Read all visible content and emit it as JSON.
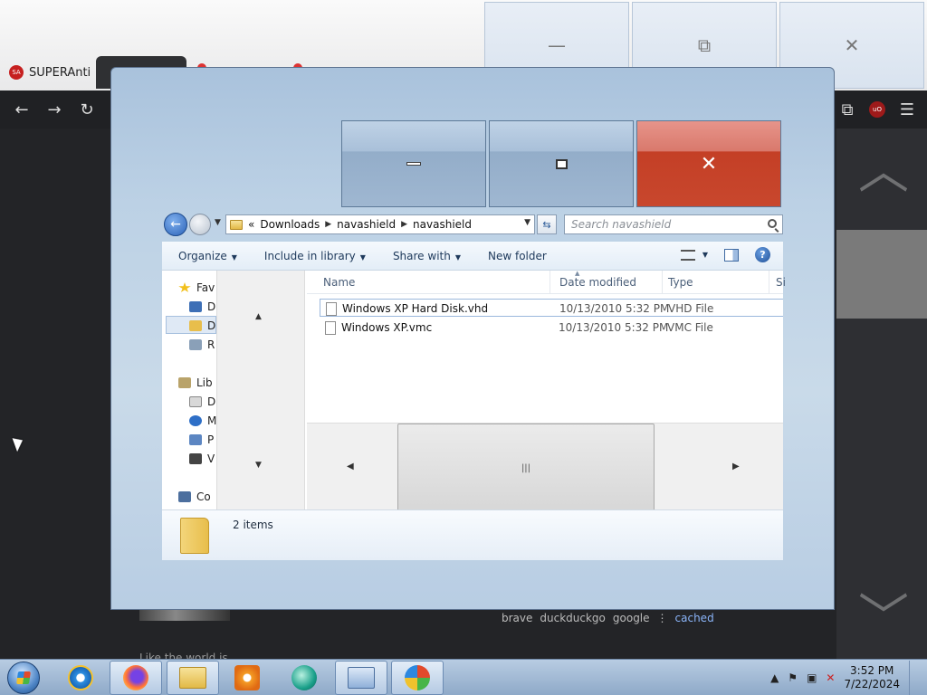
{
  "browser": {
    "tab_label": "SUPERAnti",
    "tab_icon_text": "SA",
    "ublock_text": "uO"
  },
  "top_buttons": {
    "minimize": "—",
    "restore": "⧉",
    "close": "✕"
  },
  "page": {
    "bottom_links": [
      "brave",
      "duckduckgo",
      "google",
      "⋮",
      "cached"
    ],
    "faded_text": "Like the world is..."
  },
  "explorer": {
    "breadcrumb": [
      "«",
      "Downloads",
      "navashield",
      "navashield"
    ],
    "search_placeholder": "Search navashield",
    "commands": [
      {
        "label": "Organize",
        "dropdown": true
      },
      {
        "label": "Include in library",
        "dropdown": true
      },
      {
        "label": "Share with",
        "dropdown": true
      },
      {
        "label": "New folder",
        "dropdown": false
      }
    ],
    "nav_items": [
      {
        "label": "Fav",
        "icon": "star-icon",
        "color": "#f2c01c"
      },
      {
        "label": "D",
        "icon": "desktop-icon",
        "color": "#3d6fb6"
      },
      {
        "label": "D",
        "icon": "folder-icon",
        "color": "#e8be4c"
      },
      {
        "label": "R",
        "icon": "recent-icon",
        "color": "#8aa0b8"
      },
      {
        "label": "Lib",
        "icon": "library-icon",
        "color": "#b9a36a"
      },
      {
        "label": "D",
        "icon": "document-icon",
        "color": "#d8d8d8"
      },
      {
        "label": "M",
        "icon": "music-icon",
        "color": "#2e6fc7"
      },
      {
        "label": "P",
        "icon": "pictures-icon",
        "color": "#5c86c2"
      },
      {
        "label": "V",
        "icon": "videos-icon",
        "color": "#444"
      },
      {
        "label": "Co",
        "icon": "computer-icon",
        "color": "#4c6f9e"
      }
    ],
    "columns": [
      "Name",
      "Date modified",
      "Type",
      "Si"
    ],
    "files": [
      {
        "name": "Windows XP Hard Disk.vhd",
        "date": "10/13/2010 5:32 PM",
        "type": "VHD File"
      },
      {
        "name": "Windows XP.vmc",
        "date": "10/13/2010 5:32 PM",
        "type": "VMC File"
      }
    ],
    "items_count": "2 items",
    "help": "?"
  },
  "taskbar": {
    "time": "3:52 PM",
    "date": "7/22/2024"
  }
}
